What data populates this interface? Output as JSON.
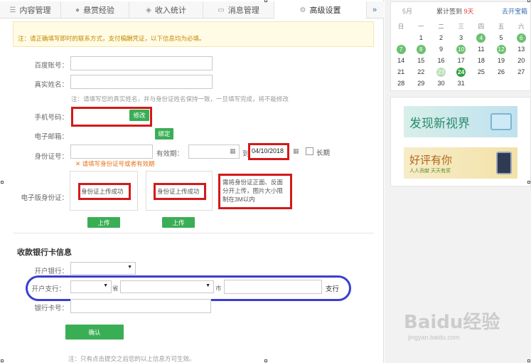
{
  "tabs": [
    {
      "label": "内容管理",
      "icon": "list-icon",
      "active": false
    },
    {
      "label": "悬赏经验",
      "icon": "reward-icon",
      "active": false
    },
    {
      "label": "收入统计",
      "icon": "shield-icon",
      "active": false
    },
    {
      "label": "消息管理",
      "icon": "message-icon",
      "active": false
    },
    {
      "label": "高级设置",
      "icon": "gear-icon",
      "active": true
    }
  ],
  "tab_more": "»",
  "notice": {
    "line1": "注：请正确填写即时的联系方式，支付稿酬凭证，以下信息均为必填。"
  },
  "form": {
    "baidu_account_label": "百度账号：",
    "real_name_label": "真实姓名：",
    "real_name_hint": "注：请填写您的真实姓名，并与身份证姓名保持一致，一旦填写完成，将不能修改",
    "phone_label": "手机号码：",
    "phone_button": "修改",
    "email_label": "电子邮箱：",
    "email_button": "绑定",
    "id_label": "身份证号：",
    "validity_label": "有效期：",
    "to_label": "到",
    "validity_end": "04/10/2018",
    "long_term_label": "长期",
    "id_warning": "请填写身份证号或者有效期",
    "eid_label": "电子版身份证：",
    "upload_status_front": "身份证上传成功",
    "upload_status_back": "身份证上传成功",
    "upload_note": "需将身份证正面、反面分开上传，图片大小限制在3M以内",
    "upload_button": "上传"
  },
  "bank": {
    "section_title": "收款银行卡信息",
    "bank_label": "开户银行：",
    "branch_label": "开户支行：",
    "province_suffix": "省",
    "city_suffix": "市",
    "branch_suffix": "支行",
    "card_label": "银行卡号：",
    "confirm_button": "确认",
    "footer_note": "注：只有点击提交之后您的以上信息方可生效。"
  },
  "calendar": {
    "month": "5月",
    "signed_prefix": "累计签到",
    "signed_days": "9天",
    "link": "去开宝箱",
    "weekdays": [
      "日",
      "一",
      "二",
      "三",
      "四",
      "五",
      "六"
    ],
    "weeks": [
      [
        {
          "d": ""
        },
        {
          "d": "1"
        },
        {
          "d": "2"
        },
        {
          "d": "3"
        },
        {
          "d": "4",
          "s": "signed"
        },
        {
          "d": "5"
        },
        {
          "d": "6",
          "s": "signed"
        }
      ],
      [
        {
          "d": "7",
          "s": "signed"
        },
        {
          "d": "8",
          "s": "signed"
        },
        {
          "d": "9"
        },
        {
          "d": "10",
          "s": "signed"
        },
        {
          "d": "11"
        },
        {
          "d": "12",
          "s": "signed"
        },
        {
          "d": "13"
        }
      ],
      [
        {
          "d": "14"
        },
        {
          "d": "15"
        },
        {
          "d": "16"
        },
        {
          "d": "17"
        },
        {
          "d": "18"
        },
        {
          "d": "19"
        },
        {
          "d": "20"
        }
      ],
      [
        {
          "d": "21"
        },
        {
          "d": "22"
        },
        {
          "d": "23",
          "s": "light"
        },
        {
          "d": "24",
          "s": "today"
        },
        {
          "d": "25"
        },
        {
          "d": "26"
        },
        {
          "d": "27"
        }
      ],
      [
        {
          "d": "28"
        },
        {
          "d": "29"
        },
        {
          "d": "30"
        },
        {
          "d": "31"
        },
        {
          "d": ""
        },
        {
          "d": ""
        },
        {
          "d": ""
        }
      ]
    ]
  },
  "ads": {
    "banner1_title": "发现新视界",
    "banner2_title": "好评有你",
    "banner2_sub": "人人贡献  天天有奖"
  },
  "watermark": {
    "logo": "Baidu经验",
    "url": "jingyan.baidu.com"
  },
  "colors": {
    "accent_green": "#3aae55",
    "highlight_red": "#d31919",
    "highlight_blue": "#3b3ed1",
    "warning_orange": "#e8731a"
  }
}
